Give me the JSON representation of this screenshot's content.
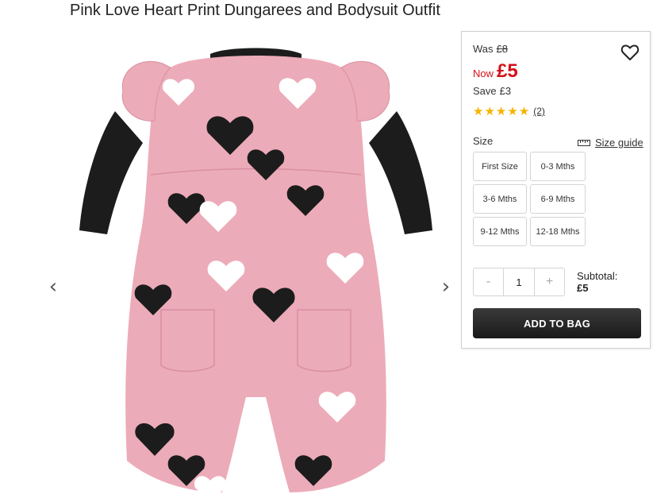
{
  "product": {
    "title": "Pink Love Heart Print Dungarees and Bodysuit Outfit"
  },
  "gallery": {
    "prev_icon": "chevron-left-icon",
    "next_icon": "chevron-right-icon",
    "prev_glyph": "‹",
    "next_glyph": "›"
  },
  "pricing": {
    "was_label": "Was",
    "was_price": "£8",
    "now_label": "Now",
    "now_price": "£5",
    "save_label": "Save",
    "save_amount": "£3",
    "accent_color": "#d50f18"
  },
  "rating": {
    "stars": 5,
    "star_glyph": "★",
    "review_count": "(2)",
    "star_color": "#f5b400"
  },
  "size": {
    "label": "Size",
    "guide_label": "Size guide",
    "options": [
      "First Size",
      "0-3 Mths",
      "3-6 Mths",
      "6-9 Mths",
      "9-12 Mths",
      "12-18 Mths"
    ]
  },
  "quantity": {
    "minus": "-",
    "value": "1",
    "plus": "+"
  },
  "subtotal": {
    "label": "Subtotal:",
    "value": "£5"
  },
  "cart": {
    "add_label": "ADD TO BAG"
  },
  "icons": {
    "wishlist": "heart-outline-icon",
    "size_guide": "ruler-icon"
  }
}
